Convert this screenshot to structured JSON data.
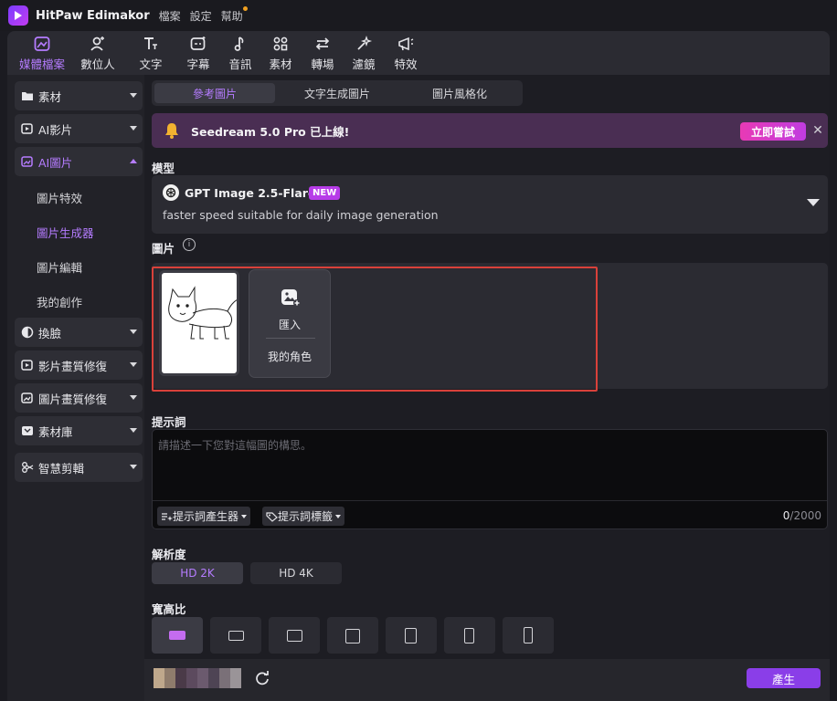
{
  "titlebar": {
    "app_name": "HitPaw Edimakor",
    "menu": [
      "檔案",
      "設定",
      "幫助"
    ]
  },
  "toolbar": {
    "items": [
      {
        "label": "媒體檔案",
        "icon": "media-files-icon",
        "active": true
      },
      {
        "label": "數位人",
        "icon": "digital-human-icon"
      },
      {
        "label": "文字",
        "icon": "text-icon"
      },
      {
        "label": "字幕",
        "icon": "subtitle-icon"
      },
      {
        "label": "音訊",
        "icon": "audio-icon"
      },
      {
        "label": "素材",
        "icon": "assets-icon"
      },
      {
        "label": "轉場",
        "icon": "transition-icon"
      },
      {
        "label": "濾鏡",
        "icon": "filter-icon"
      },
      {
        "label": "特效",
        "icon": "effects-icon"
      }
    ]
  },
  "sidebar": {
    "items": [
      {
        "label": "素材",
        "icon": "folder-icon"
      },
      {
        "label": "AI影片",
        "icon": "ai-video-icon"
      },
      {
        "label": "AI圖片",
        "icon": "ai-image-icon",
        "open": true
      },
      {
        "label": "換臉",
        "icon": "face-swap-icon"
      },
      {
        "label": "影片畫質修復",
        "icon": "video-enhance-icon"
      },
      {
        "label": "圖片畫質修復",
        "icon": "image-enhance-icon"
      },
      {
        "label": "素材庫",
        "icon": "library-icon"
      },
      {
        "label": "智慧剪輯",
        "icon": "smart-edit-icon"
      }
    ],
    "subitems": [
      {
        "label": "圖片特效"
      },
      {
        "label": "圖片生成器",
        "active": true
      },
      {
        "label": "圖片編輯"
      },
      {
        "label": "我的創作"
      }
    ]
  },
  "main": {
    "tabs": [
      {
        "label": "參考圖片",
        "active": true
      },
      {
        "label": "文字生成圖片"
      },
      {
        "label": "圖片風格化"
      }
    ],
    "banner": {
      "text": "Seedream 5.0 Pro 已上線!",
      "button": "立即嘗試",
      "close": "✕"
    },
    "model": {
      "section_label": "模型",
      "name": "GPT Image 2.5-Flare",
      "badge": "NEW",
      "description": "faster speed suitable for daily image generation"
    },
    "images": {
      "section_label": "圖片",
      "info": "i",
      "import_label": "匯入",
      "my_character": "我的角色"
    },
    "prompt": {
      "section_label": "提示詞",
      "placeholder": "請描述一下您對這幅圖的構思。",
      "value": "",
      "generator_chip": "提示詞產生器",
      "tags_chip": "提示詞標籤",
      "count": "0",
      "max": "/2000"
    },
    "resolution": {
      "section_label": "解析度",
      "options": [
        "HD 2K",
        "HD 4K"
      ],
      "selected": "HD 2K"
    },
    "aspect_ratio": {
      "section_label": "寬高比",
      "selected_index": 0,
      "count": 7
    },
    "footer": {
      "generate_button": "產生"
    }
  },
  "colors": {
    "accent": "#b57cff",
    "banner_bg": "#4a2e53",
    "try_button": "#e83ab5",
    "generate_button": "#8a3ee8",
    "highlight_border": "#d9413a"
  }
}
